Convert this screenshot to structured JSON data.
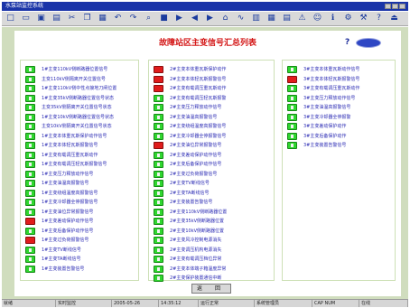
{
  "window": {
    "title": "水泵站监控系统"
  },
  "toolbar": {
    "icons": [
      "new-icon",
      "open-icon",
      "save-icon",
      "print-icon",
      "cut-icon",
      "copy-icon",
      "paste-icon",
      "undo-icon",
      "redo-icon",
      "zoom-icon",
      "stop-icon",
      "play-icon",
      "back-icon",
      "forward-icon",
      "home-icon",
      "trend-icon",
      "chart-icon",
      "table-icon",
      "report-icon",
      "alarm-icon",
      "user-icon",
      "info-icon",
      "settings-icon",
      "tools-icon",
      "help-icon",
      "exit-icon"
    ]
  },
  "header": {
    "title": "故障站区主变信号汇总列表",
    "help_symbol": "?"
  },
  "columns": [
    {
      "rows": [
        {
          "status": "ok",
          "label": "1#主变110kV侧断路器位置信号"
        },
        {
          "status": "ok",
          "label": "主变110kV侧隔离开关位置信号"
        },
        {
          "status": "ok",
          "label": "1#主变110kV侧中性点接地刀闸位置"
        },
        {
          "status": "ok",
          "label": "1#主变35kV侧断路器位置信号状态"
        },
        {
          "status": "ok",
          "label": "主变35kV侧隔离开关位置信号状态"
        },
        {
          "status": "ok",
          "label": "1#主变10kV侧断路器位置信号状态"
        },
        {
          "status": "ok",
          "label": "主变10kV侧隔离开关位置信号状态"
        },
        {
          "status": "ok",
          "label": "1#主变本体重瓦斯保护动作信号"
        },
        {
          "status": "ok",
          "label": "1#主变本体轻瓦斯报警信号"
        },
        {
          "status": "ok",
          "label": "1#主变有载调压重瓦斯动作"
        },
        {
          "status": "ok",
          "label": "1#主变有载调压轻瓦斯报警信号"
        },
        {
          "status": "ok",
          "label": "1#主变压力释放动作信号"
        },
        {
          "status": "ok",
          "label": "1#主变油温高报警信号"
        },
        {
          "status": "ok",
          "label": "1#主变绕组温度高报警信号"
        },
        {
          "status": "ok",
          "label": "1#主变冷却器全停报警信号"
        },
        {
          "status": "ok",
          "label": "1#主变油位异常报警信号"
        },
        {
          "status": "alarm",
          "label": "1#主变差动保护动作信号"
        },
        {
          "status": "ok",
          "label": "1#主变后备保护动作信号"
        },
        {
          "status": "alarm",
          "label": "1#主变过负荷报警信号"
        },
        {
          "status": "ok",
          "label": "1#主变TV断线信号"
        },
        {
          "status": "ok",
          "label": "1#主变TA断线信号"
        },
        {
          "status": "ok",
          "label": "1#主变装置告警信号"
        }
      ]
    },
    {
      "rows": [
        {
          "status": "alarm",
          "label": "2#主变本体重瓦斯保护动作"
        },
        {
          "status": "alarm",
          "label": "2#主变本体轻瓦斯报警信号"
        },
        {
          "status": "alarm",
          "label": "2#主变有载调压重瓦斯动作"
        },
        {
          "status": "ok",
          "label": "2#主变有载调压轻瓦斯报警"
        },
        {
          "status": "ok",
          "label": "2#主变压力释放动作信号"
        },
        {
          "status": "ok",
          "label": "2#主变油温高报警信号"
        },
        {
          "status": "ok",
          "label": "2#主变绕组温度高报警信号"
        },
        {
          "status": "ok",
          "label": "2#主变冷却器全停报警信号"
        },
        {
          "status": "alarm",
          "label": "2#主变油位异常报警信号"
        },
        {
          "status": "ok",
          "label": "2#主变差动保护动作信号"
        },
        {
          "status": "ok",
          "label": "2#主变后备保护动作信号"
        },
        {
          "status": "ok",
          "label": "2#主变过负荷报警信号"
        },
        {
          "status": "ok",
          "label": "2#主变TV断线信号"
        },
        {
          "status": "ok",
          "label": "2#主变TA断线信号"
        },
        {
          "status": "ok",
          "label": "2#主变装置告警信号"
        },
        {
          "status": "ok",
          "label": "2#主变110kV侧断路器位置"
        },
        {
          "status": "ok",
          "label": "2#主变35kV侧断路器位置"
        },
        {
          "status": "ok",
          "label": "2#主变10kV侧断路器位置"
        },
        {
          "status": "ok",
          "label": "2#主变风冷控制电源消失"
        },
        {
          "status": "ok",
          "label": "2#主变调压机构电源消失"
        },
        {
          "status": "ok",
          "label": "2#主变有载调压档位异常"
        },
        {
          "status": "ok",
          "label": "2#主变本体端子箱温度异常"
        },
        {
          "status": "ok",
          "label": "2#主变保护装置通信中断"
        }
      ]
    },
    {
      "rows": [
        {
          "status": "ok",
          "label": "3#主变本体重瓦斯动作信号"
        },
        {
          "status": "alarm",
          "label": "3#主变本体轻瓦斯报警信号"
        },
        {
          "status": "ok",
          "label": "3#主变有载调压重瓦斯动作"
        },
        {
          "status": "ok",
          "label": "3#主变压力释放动作信号"
        },
        {
          "status": "ok",
          "label": "3#主变油温高报警信号"
        },
        {
          "status": "ok",
          "label": "3#主变冷却器全停报警"
        },
        {
          "status": "ok",
          "label": "3#主变差动保护动作"
        },
        {
          "status": "ok",
          "label": "3#主变后备保护动作"
        },
        {
          "status": "ok",
          "label": "3#主变装置告警信号"
        }
      ]
    }
  ],
  "footer": {
    "return_label": "返 回"
  },
  "statusbar": {
    "segments": [
      "就绪",
      "实时监控",
      "2005-05-26",
      "14:35:12",
      "运行正常",
      "系统管理员",
      "CAP NUM",
      "在线"
    ]
  }
}
